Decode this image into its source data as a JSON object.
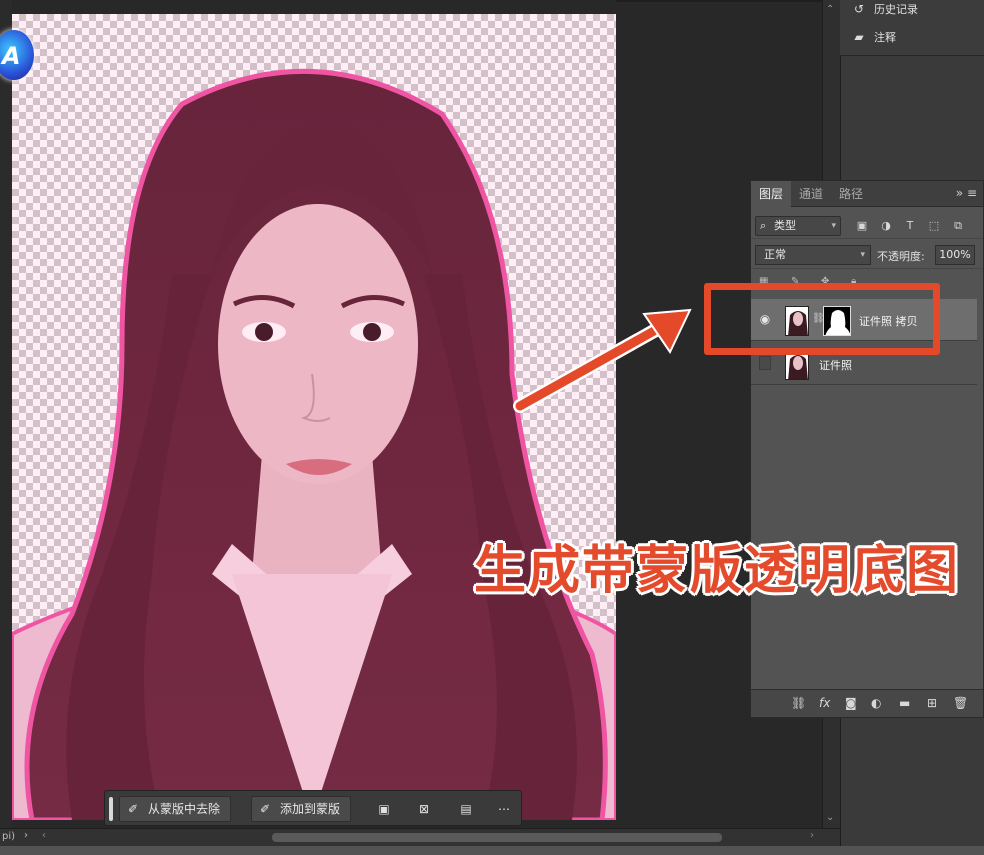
{
  "history_panel": {
    "items": [
      {
        "icon": "history-icon",
        "label": "历史记录"
      },
      {
        "icon": "comment-icon",
        "label": "注释"
      }
    ]
  },
  "layers_panel": {
    "tabs": [
      "图层",
      "通道",
      "路径"
    ],
    "active_tab": "图层",
    "filter": {
      "selected": "类型"
    },
    "blend_mode": "正常",
    "opacity_label": "不透明度:",
    "opacity_value": "100%",
    "layers": [
      {
        "name": "证件照 拷贝",
        "visible": true,
        "selected": true,
        "has_mask": true
      },
      {
        "name": "证件照",
        "visible": false,
        "selected": false,
        "has_mask": false
      }
    ]
  },
  "mask_toolbar": {
    "subtract_label": "从蒙版中去除",
    "add_label": "添加到蒙版"
  },
  "status": {
    "zoom_fragment": "pi)"
  },
  "caption": "生成带蒙版透明底图",
  "colors": {
    "accent": "#e4492a",
    "panel_bg": "#535353",
    "canvas_bg": "#282828"
  }
}
